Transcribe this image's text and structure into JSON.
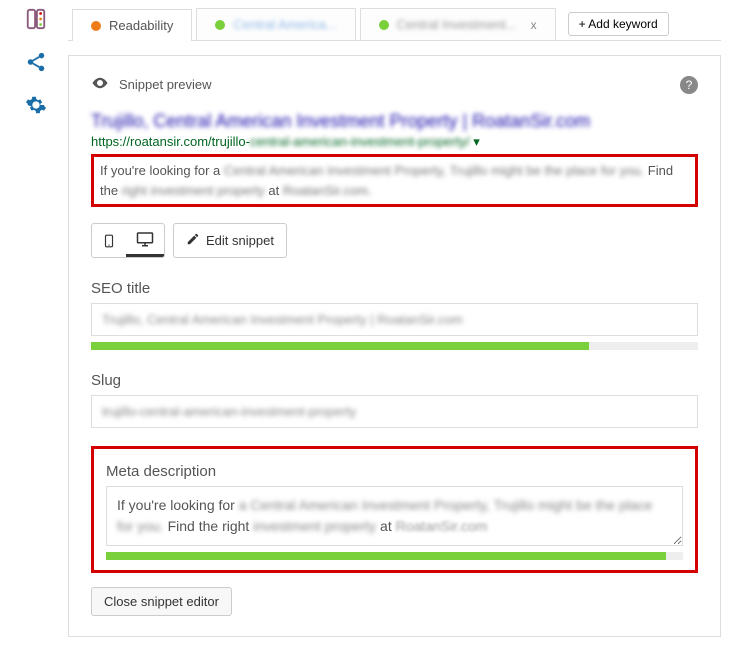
{
  "sidebar": {
    "icons": [
      "traffic-light",
      "share",
      "gear"
    ]
  },
  "tabs": {
    "items": [
      {
        "label": "Readability",
        "color": "orange"
      },
      {
        "label": "Central America...",
        "color": "green"
      },
      {
        "label": "Central Investment...",
        "color": "green",
        "closable": true
      }
    ],
    "add_label": "+ Add keyword"
  },
  "snippet": {
    "heading": "Snippet preview",
    "title": "Trujillo, Central American Investment Property | RoatanSir.com",
    "url_plain": "https://roatansir.com/trujillo-",
    "url_blur": "central-american-investment-property/",
    "desc_pre": "If you're looking for a ",
    "desc_mid_blur": "Central American Investment Property, Trujillo might be the place for you.",
    "desc_find": " Find the ",
    "desc_blur2": "right investment property",
    "desc_at": " at ",
    "desc_blur3": "RoatanSir.com.",
    "edit_label": "Edit snippet"
  },
  "fields": {
    "seo_title_label": "SEO title",
    "seo_title_value": "Trujillo, Central American Investment Property | RoatanSir.com",
    "seo_title_bar_percent": 82,
    "slug_label": "Slug",
    "slug_value": "trujillo-central-american-investment-property",
    "meta_label": "Meta description",
    "meta_pre": "If you're looking for ",
    "meta_blur1": "a Central American Investment Property, Trujillo might be the place for you.",
    "meta_mid": " Find the right ",
    "meta_blur2": "investment property",
    "meta_at": " at ",
    "meta_red": "RoatanSir.com",
    "meta_bar_percent": 97
  },
  "buttons": {
    "close_snippet": "Close snippet editor"
  }
}
